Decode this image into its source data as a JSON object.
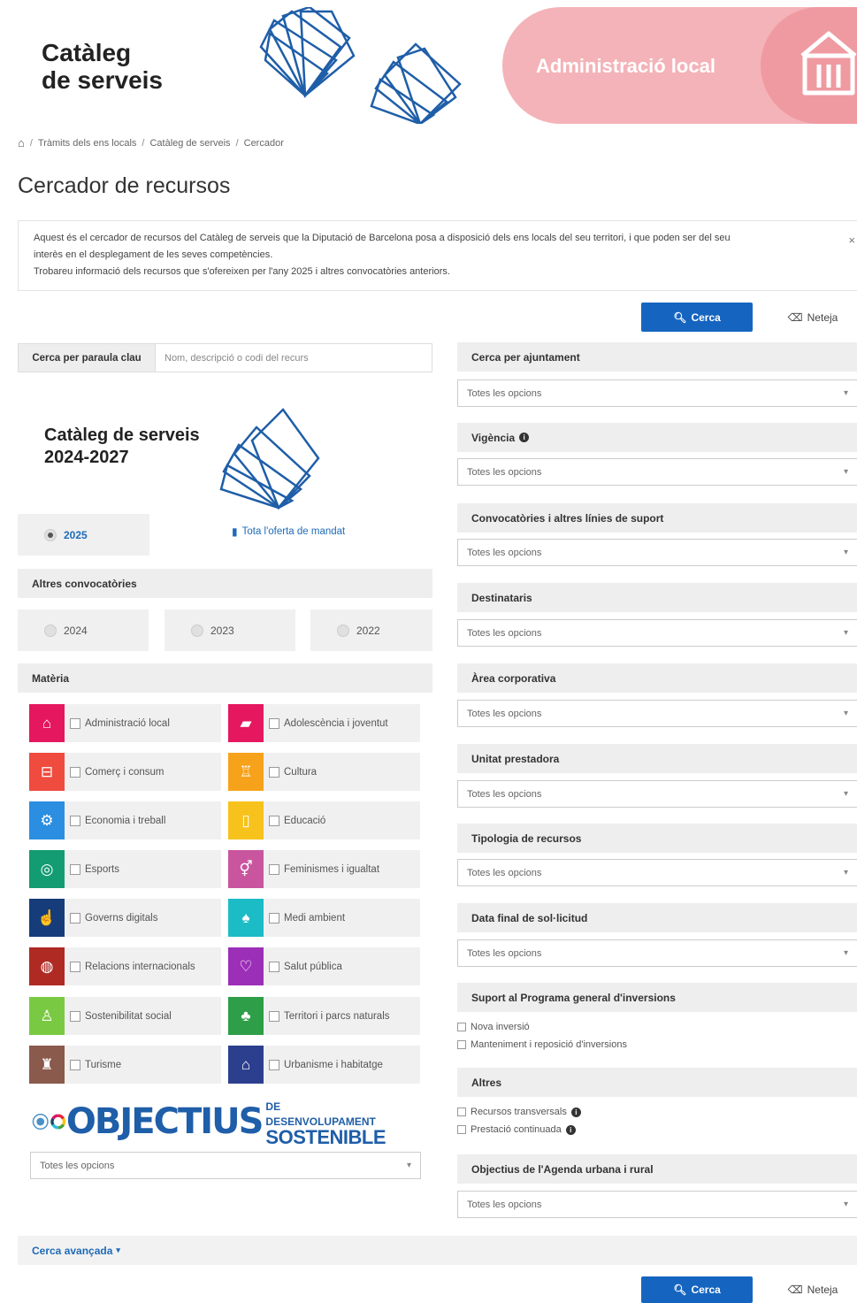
{
  "header": {
    "catalog_title_line1": "Catàleg",
    "catalog_title_line2": "de serveis",
    "section_label": "Administració local"
  },
  "breadcrumb": {
    "items": [
      "Tràmits dels ens locals",
      "Catàleg de serveis",
      "Cercador"
    ]
  },
  "page_title": "Cercador de recursos",
  "info": {
    "line1": "Aquest és el cercador de recursos del Catàleg de serveis que la Diputació de Barcelona posa a disposició dels ens locals del seu territori, i que poden ser del seu",
    "line2": "interès en el desplegament de les seves competències.",
    "line3": "Trobareu informació dels recursos que s'ofereixen per l'any 2025 i altres convocatòries anteriors.",
    "close": "×"
  },
  "actions": {
    "search_label": "Cerca",
    "clear_label": "Neteja"
  },
  "keyword": {
    "label": "Cerca per paraula clau",
    "placeholder": "Nom, descripció o codi del recurs"
  },
  "catalog_block": {
    "title_line1": "Catàleg de serveis",
    "title_line2": "2024-2027",
    "current_year": "2025",
    "offer_link": "Tota l'oferta de mandat"
  },
  "other_calls": {
    "label": "Altres convocatòries",
    "years": [
      "2024",
      "2023",
      "2022"
    ]
  },
  "materia": {
    "label": "Matèria",
    "items": [
      {
        "label": "Administració local",
        "color": "#e5175f",
        "icon": "⌂"
      },
      {
        "label": "Adolescència i joventut",
        "color": "#e5175f",
        "icon": "▰"
      },
      {
        "label": "Comerç i consum",
        "color": "#ef4b3f",
        "icon": "⊟"
      },
      {
        "label": "Cultura",
        "color": "#f7a21b",
        "icon": "♖"
      },
      {
        "label": "Economia i treball",
        "color": "#2b8ee0",
        "icon": "⚙"
      },
      {
        "label": "Educació",
        "color": "#f7c21b",
        "icon": "▯"
      },
      {
        "label": "Esports",
        "color": "#139c72",
        "icon": "◎"
      },
      {
        "label": "Feminismes i igualtat",
        "color": "#c9559f",
        "icon": "⚥"
      },
      {
        "label": "Governs digitals",
        "color": "#163c7a",
        "icon": "☝"
      },
      {
        "label": "Medi ambient",
        "color": "#1cbcc7",
        "icon": "♠"
      },
      {
        "label": "Relacions internacionals",
        "color": "#b02a24",
        "icon": "◍"
      },
      {
        "label": "Salut pública",
        "color": "#9b2fb8",
        "icon": "♡"
      },
      {
        "label": "Sostenibilitat social",
        "color": "#7ac943",
        "icon": "♙"
      },
      {
        "label": "Territori i parcs naturals",
        "color": "#2e9e48",
        "icon": "♣"
      },
      {
        "label": "Turisme",
        "color": "#8a5a4c",
        "icon": "♜"
      },
      {
        "label": "Urbanisme i habitatge",
        "color": "#2c3f8f",
        "icon": "⌂"
      }
    ]
  },
  "ods": {
    "main": "OBJECTIUS",
    "sub1": "DE DESENVOLUPAMENT",
    "sub2": "SOSTENIBLE",
    "select_value": "Totes les opcions"
  },
  "filters": [
    {
      "label": "Cerca per ajuntament",
      "value": "Totes les opcions"
    },
    {
      "label": "Vigència",
      "value": "Totes les opcions"
    },
    {
      "label": "Convocatòries i altres línies de suport",
      "value": "Totes les opcions"
    },
    {
      "label": "Destinataris",
      "value": "Totes les opcions"
    },
    {
      "label": "Àrea corporativa",
      "value": "Totes les opcions"
    },
    {
      "label": "Unitat prestadora",
      "value": "Totes les opcions"
    },
    {
      "label": "Tipologia de recursos",
      "value": "Totes les opcions"
    },
    {
      "label": "Data final de sol·licitud",
      "value": "Totes les opcions"
    }
  ],
  "investment": {
    "label": "Suport al Programa general d'inversions",
    "options": [
      "Nova inversió",
      "Manteniment i reposició d'inversions"
    ]
  },
  "others": {
    "label": "Altres",
    "options": [
      "Recursos transversals",
      "Prestació continuada"
    ]
  },
  "agenda": {
    "label": "Objectius de l'Agenda urbana i rural",
    "value": "Totes les opcions"
  },
  "advanced": {
    "label": "Cerca avançada"
  }
}
